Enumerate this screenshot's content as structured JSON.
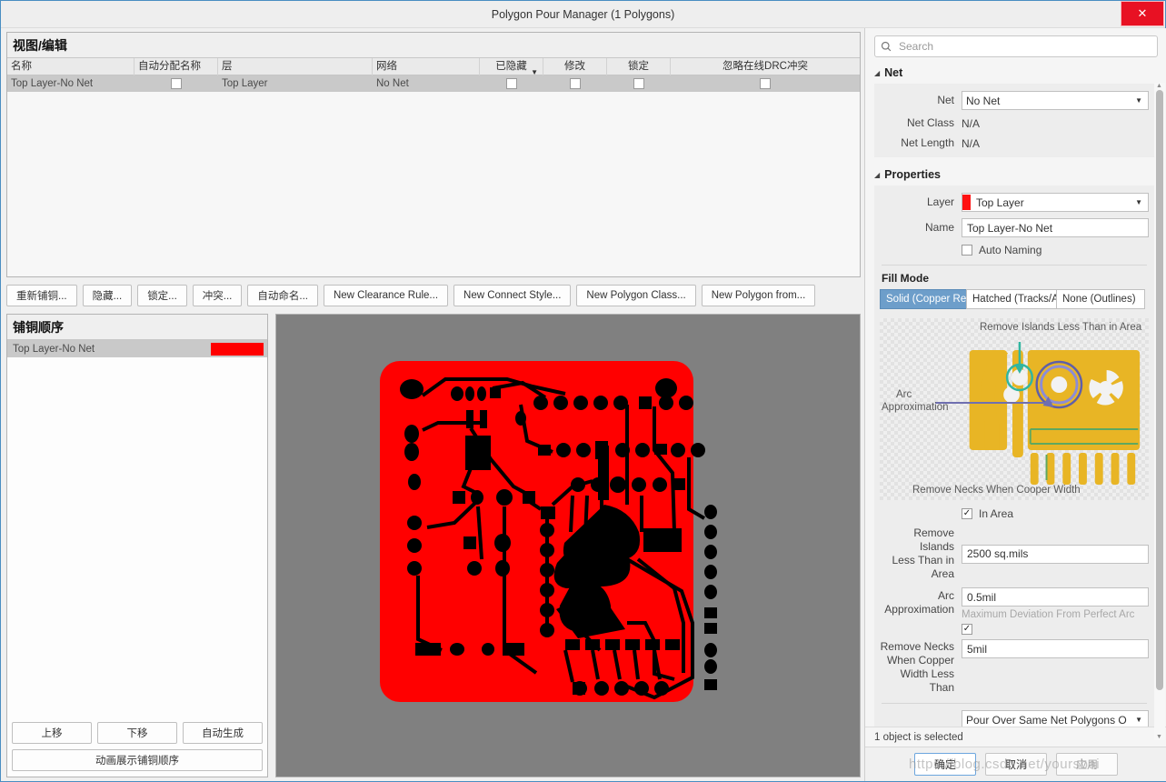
{
  "window": {
    "title": "Polygon Pour Manager (1 Polygons)",
    "close_icon": "close-icon"
  },
  "view_edit": {
    "header": "视图/编辑",
    "columns": [
      "名称",
      "自动分配名称",
      "层",
      "网络",
      "已隐藏",
      "修改",
      "锁定",
      "忽略在线DRC冲突"
    ],
    "rows": [
      {
        "name": "Top Layer-No Net",
        "auto_name": false,
        "layer": "Top Layer",
        "net": "No Net",
        "hidden": false,
        "modified": false,
        "locked": false,
        "ignore_drc": false
      }
    ],
    "buttons": [
      "重新铺铜...",
      "隐藏...",
      "锁定...",
      "冲突...",
      "自动命名...",
      "New Clearance Rule...",
      "New Connect Style...",
      "New Polygon Class...",
      "New Polygon from..."
    ]
  },
  "pour_order": {
    "header": "铺铜顺序",
    "rows": [
      {
        "name": "Top Layer-No Net",
        "color": "#ff0000"
      }
    ],
    "buttons": [
      "上移",
      "下移",
      "自动生成"
    ],
    "animate_button": "动画展示铺铜顺序"
  },
  "preview": {
    "background": "#808080",
    "copper_color": "#ff0000",
    "trace_color": "#000000"
  },
  "properties_panel": {
    "search": {
      "placeholder": "Search",
      "value": "",
      "icon": "search-icon"
    },
    "net_section": {
      "title": "Net",
      "net_label": "Net",
      "net_value": "No Net",
      "net_class_label": "Net Class",
      "net_class_value": "N/A",
      "net_length_label": "Net Length",
      "net_length_value": "N/A"
    },
    "properties_section": {
      "title": "Properties",
      "layer_label": "Layer",
      "layer_value": "Top Layer",
      "layer_color": "#ff1111",
      "name_label": "Name",
      "name_value": "Top Layer-No Net",
      "auto_naming_label": "Auto Naming",
      "auto_naming_checked": false,
      "fill_mode_label": "Fill Mode",
      "fill_modes": [
        {
          "label": "Solid (Copper Regions)",
          "selected": true
        },
        {
          "label": "Hatched (Tracks/Arcs)",
          "selected": false
        },
        {
          "label": "None (Outlines)",
          "selected": false
        }
      ]
    },
    "illustration": {
      "label_top": "Remove Islands Less Than in Area",
      "label_left": "Arc\nApproximation",
      "label_left_line1": "Arc",
      "label_left_line2": "Approximation",
      "label_bottom": "Remove Necks When Cooper Width"
    },
    "fields": {
      "in_area_label": "In Area",
      "in_area_checked": true,
      "remove_islands_label": "Remove Islands Less Than in Area",
      "remove_islands_label_l1": "Remove Islands",
      "remove_islands_label_l2": "Less Than in Area",
      "remove_islands_value": "2500 sq.mils",
      "arc_label_l1": "Arc",
      "arc_label_l2": "Approximation",
      "arc_value": "0.5mil",
      "arc_hint": "Maximum Deviation From Perfect Arc",
      "necks_checked": true,
      "necks_label_l1": "Remove Necks",
      "necks_label_l2": "When Copper",
      "necks_label_l3": "Width Less Than",
      "necks_value": "5mil",
      "pour_over_value": "Pour Over Same Net Polygons O"
    },
    "status": "1 object is selected"
  },
  "footer": {
    "ok": "确定",
    "cancel": "取消",
    "apply": "应用"
  },
  "watermark": "https://blog.csdn.net/yoursbai"
}
